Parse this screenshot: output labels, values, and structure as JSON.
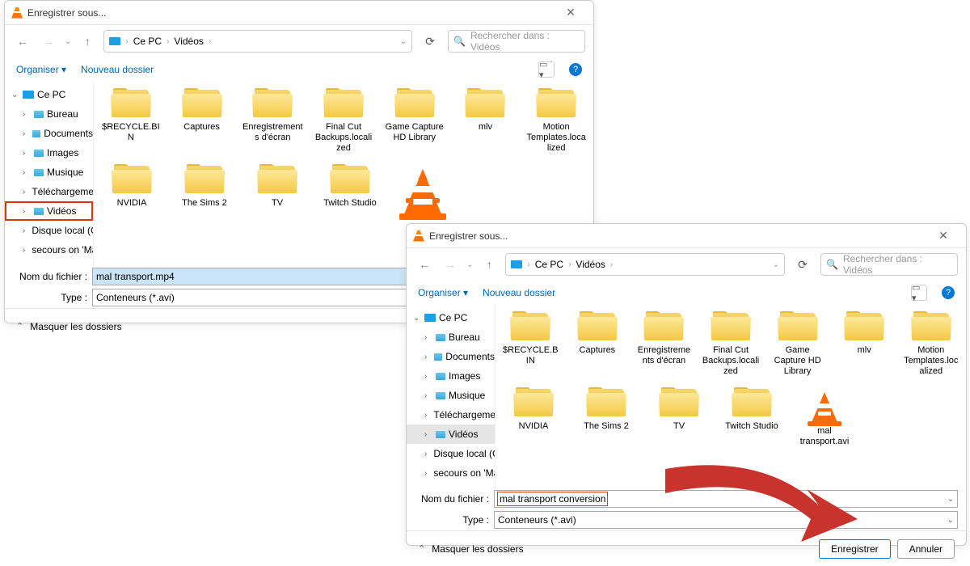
{
  "dialog_title": "Enregistrer sous...",
  "breadcrumb": {
    "pc": "Ce PC",
    "folder": "Vidéos"
  },
  "search_placeholder": "Rechercher dans : Vidéos",
  "toolbar": {
    "organize": "Organiser",
    "new_folder": "Nouveau dossier"
  },
  "sidebar": {
    "root": "Ce PC",
    "items": [
      "Bureau",
      "Documents",
      "Images",
      "Musique",
      "Téléchargemen",
      "Vidéos",
      "Disque local (C",
      "secours on 'Ma"
    ]
  },
  "folders_row1": [
    "$RECYCLE.BIN",
    "Captures",
    "Enregistrements d'écran",
    "Final Cut Backups.localized",
    "Game Capture HD Library",
    "mlv",
    "Motion Templates.localized"
  ],
  "folders_row2": [
    "NVIDIA",
    "The Sims 2",
    "TV",
    "Twitch Studio"
  ],
  "vlc_file_partial": "mal t",
  "vlc_file_full": "mal transport.avi",
  "form": {
    "filename_label": "Nom du fichier :",
    "type_label": "Type :",
    "type_value": "Conteneurs (*.avi)",
    "filename_value1": "mal transport.mp4",
    "filename_value2": "mal transport conversion"
  },
  "footer": {
    "hide": "Masquer les dossiers",
    "save": "Enregistrer",
    "cancel": "Annuler"
  }
}
